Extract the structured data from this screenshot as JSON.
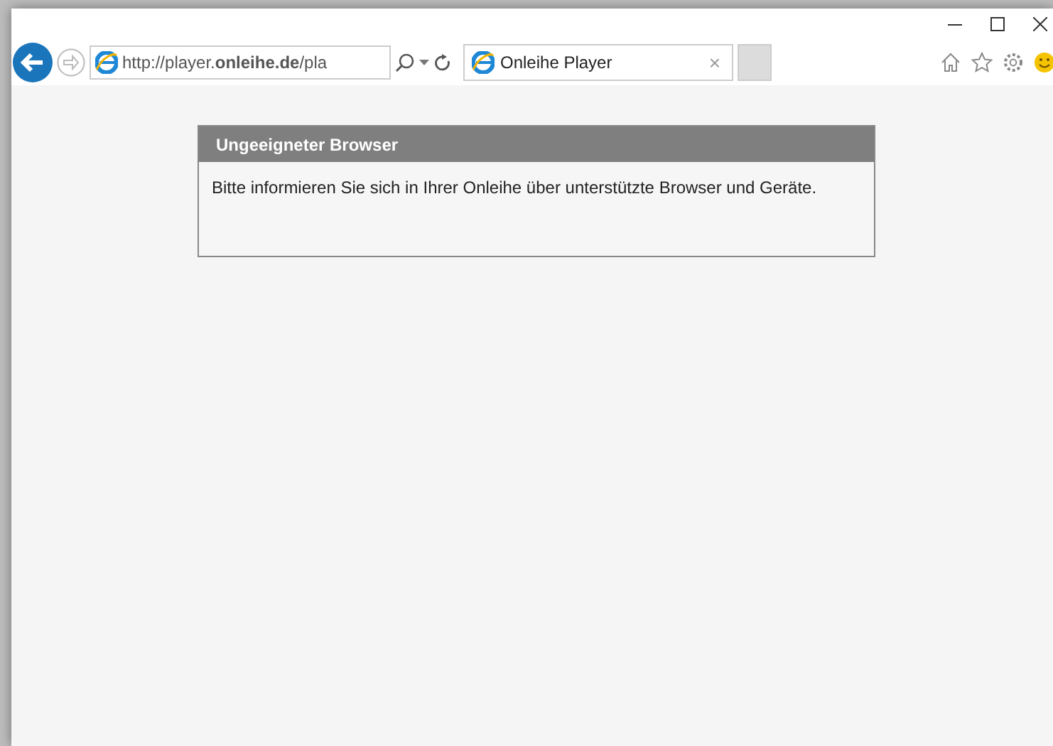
{
  "address_bar": {
    "url": "http://player.**onleihe.de**/pla"
  },
  "tabs": [
    {
      "title": "Onleihe Player",
      "close": "×",
      "selected": true
    }
  ],
  "dialog": {
    "title": "Ungeeigneter Browser",
    "message": "Bitte informieren Sie sich in Ihrer Onleihe über unterstützte Browser und Geräte."
  }
}
